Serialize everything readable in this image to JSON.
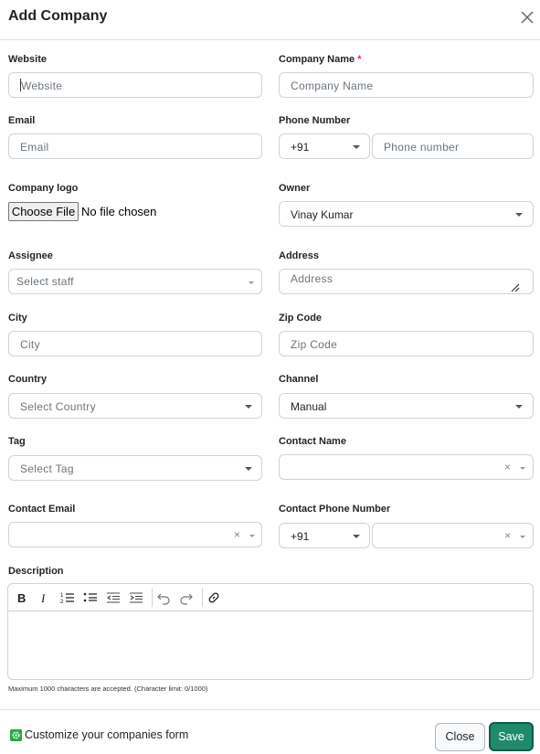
{
  "modal": {
    "title": "Add Company"
  },
  "fields": {
    "website": {
      "label": "Website",
      "placeholder": "Website"
    },
    "company_name": {
      "label": "Company Name",
      "required_mark": "*",
      "placeholder": "Company Name"
    },
    "email": {
      "label": "Email",
      "placeholder": "Email"
    },
    "phone_number": {
      "label": "Phone Number",
      "country_code": "+91",
      "placeholder": "Phone number"
    },
    "company_logo": {
      "label": "Company logo",
      "button": "Choose File",
      "status": "No file chosen"
    },
    "owner": {
      "label": "Owner",
      "value": "Vinay Kumar"
    },
    "assignee": {
      "label": "Assignee",
      "placeholder": "Select staff"
    },
    "address": {
      "label": "Address",
      "placeholder": "Address"
    },
    "city": {
      "label": "City",
      "placeholder": "City"
    },
    "zip_code": {
      "label": "Zip Code",
      "placeholder": "Zip Code"
    },
    "country": {
      "label": "Country",
      "placeholder": "Select Country"
    },
    "channel": {
      "label": "Channel",
      "value": "Manual"
    },
    "tag": {
      "label": "Tag",
      "placeholder": "Select Tag"
    },
    "contact_name": {
      "label": "Contact Name",
      "clear": "×"
    },
    "contact_email": {
      "label": "Contact Email",
      "clear": "×"
    },
    "contact_phone": {
      "label": "Contact Phone Number",
      "country_code": "+91",
      "clear": "×"
    },
    "description": {
      "label": "Description",
      "toolbar": [
        "bold-icon",
        "italic-icon",
        "ordered-list-icon",
        "bullet-list-icon",
        "outdent-icon",
        "indent-icon",
        "undo-icon",
        "redo-icon",
        "link-icon"
      ],
      "limit_text": "Maximum 1000 characters are accepted.  (Character limit: 0/1000)"
    }
  },
  "footer": {
    "customize_text": "Customize your companies form",
    "close_label": "Close",
    "save_label": "Save"
  },
  "colors": {
    "primary": "#1f8a6c",
    "required": "#dc3545",
    "border": "#ced4da",
    "customize_icon": "#28a745"
  }
}
